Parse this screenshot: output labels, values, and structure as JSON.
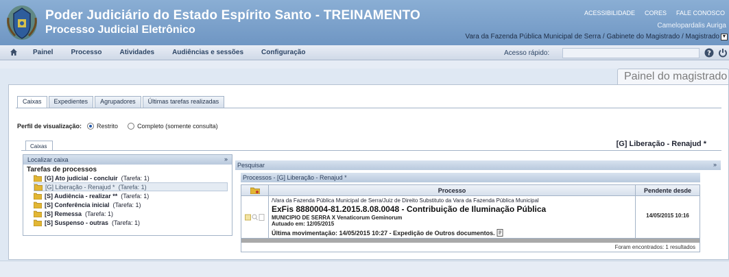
{
  "header": {
    "title": "Poder Judiciário do Estado Espírito Santo - TREINAMENTO",
    "subtitle": "Processo Judicial Eletrônico",
    "links": [
      "ACESSIBILIDADE",
      "CORES",
      "FALE CONOSCO"
    ],
    "username": "Camelopardalis Auriga",
    "organ_select": "Vara da Fazenda Pública Municipal de Serra / Gabinete do Magistrado / Magistrado"
  },
  "menu": {
    "items": [
      "Painel",
      "Processo",
      "Atividades",
      "Audiências e sessões",
      "Configuração"
    ],
    "quick_access_label": "Acesso rápido:",
    "quick_access_value": ""
  },
  "page_title": "Painel do magistrado",
  "tabs": [
    "Caixas",
    "Expedientes",
    "Agrupadores",
    "Últimas tarefas realizadas"
  ],
  "perfil": {
    "label": "Perfil de visualização:",
    "options": [
      "Restrito",
      "Completo (somente consulta)"
    ],
    "selected": "Restrito"
  },
  "caixas_tab": "Caixas",
  "right_heading": "[G] Liberação - Renajud *",
  "left": {
    "localizar": "Localizar caixa",
    "collapse": "»",
    "tree_title": "Tarefas de processos",
    "items": [
      {
        "name": "[G] Ato judicial - concluir",
        "count": "(Tarefa: 1)"
      },
      {
        "name": "[G] Liberação - Renajud *",
        "count": "(Tarefa: 1)"
      },
      {
        "name": "[S] Audiência - realizar **",
        "count": "(Tarefa: 1)"
      },
      {
        "name": "[S] Conferência inicial",
        "count": "(Tarefa: 1)"
      },
      {
        "name": "[S] Remessa",
        "count": "(Tarefa: 1)"
      },
      {
        "name": "[S] Suspenso - outras",
        "count": "(Tarefa: 1)"
      }
    ]
  },
  "pesquisar": {
    "label": "Pesquisar",
    "collapse": "»"
  },
  "processos": {
    "bar": "Processos - [G] Liberação - Renajud *",
    "col_processo": "Processo",
    "col_pendente": "Pendente desde",
    "row": {
      "orgao": "/Vara da Fazenda Pública Municipal de Serra/Juiz de Direito Substituto da Vara da Fazenda Pública Municipal",
      "numero": "ExFis 8880004-81.2015.8.08.0048 - Contribuição de Iluminação Pública",
      "partes": "MUNICIPIO DE SERRA X Venaticorum Geminorum",
      "autuado": "Autuado em: 12/05/2015",
      "movimentacao": "Última movimentação: 14/05/2015 10:27 - Expedição de Outros documentos.",
      "pendente": "14/05/2015 10:16"
    },
    "footer": "Foram encontrados: 1 resultados"
  }
}
